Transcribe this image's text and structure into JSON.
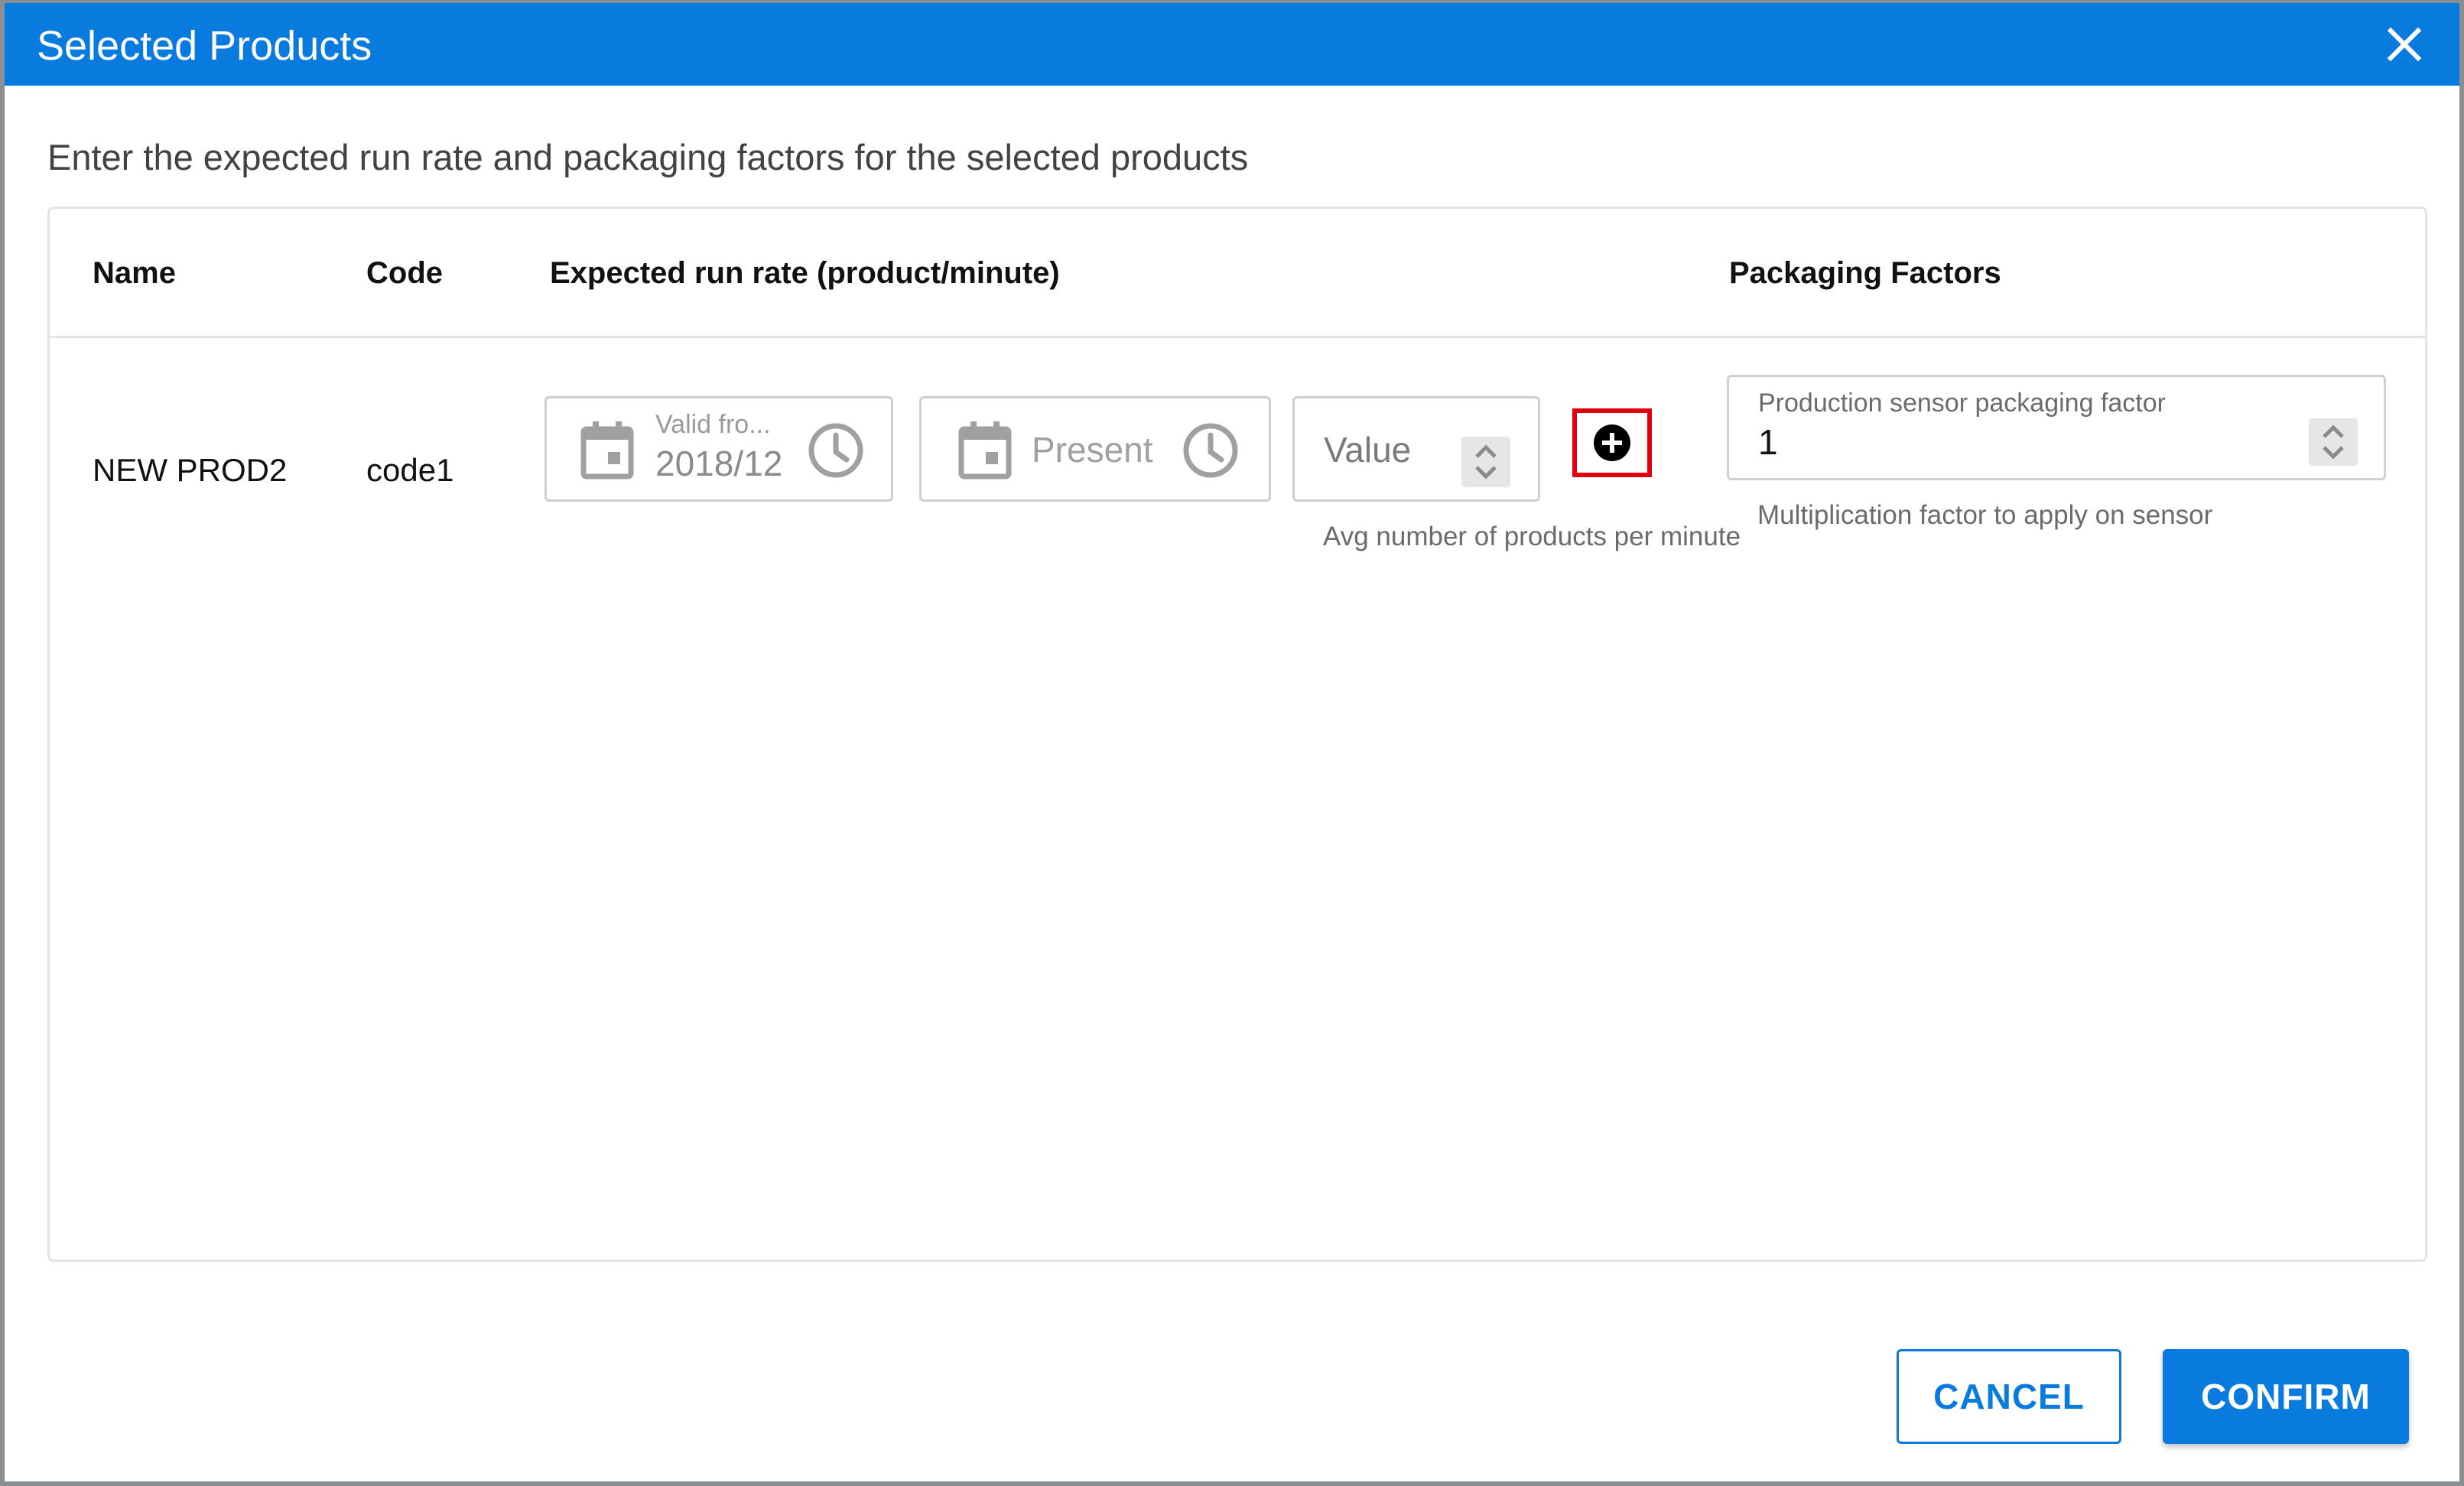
{
  "dialog": {
    "title": "Selected Products",
    "subtitle": "Enter the expected run rate and packaging factors for the selected products"
  },
  "table": {
    "columns": [
      "Name",
      "Code",
      "Expected run rate (product/minute)",
      "Packaging Factors"
    ],
    "row": {
      "name": "NEW PROD2",
      "code": "code1",
      "valid_from": {
        "label": "Valid fro...",
        "value": "2018/12"
      },
      "valid_to": {
        "placeholder": "Present"
      },
      "run_rate": {
        "placeholder": "Value",
        "helper": "Avg number of products per minute"
      },
      "packaging_factor": {
        "label": "Production sensor packaging factor",
        "value": "1",
        "helper": "Multiplication factor to apply on sensor"
      }
    }
  },
  "actions": {
    "cancel_label": "CANCEL",
    "confirm_label": "CONFIRM"
  },
  "colors": {
    "primary": "#0a7bde",
    "highlight": "#e0000e"
  },
  "icons": {
    "close": "close-icon",
    "calendar": "calendar-icon",
    "clock": "clock-icon",
    "stepper": "stepper-icon",
    "add": "add-circle-icon"
  }
}
